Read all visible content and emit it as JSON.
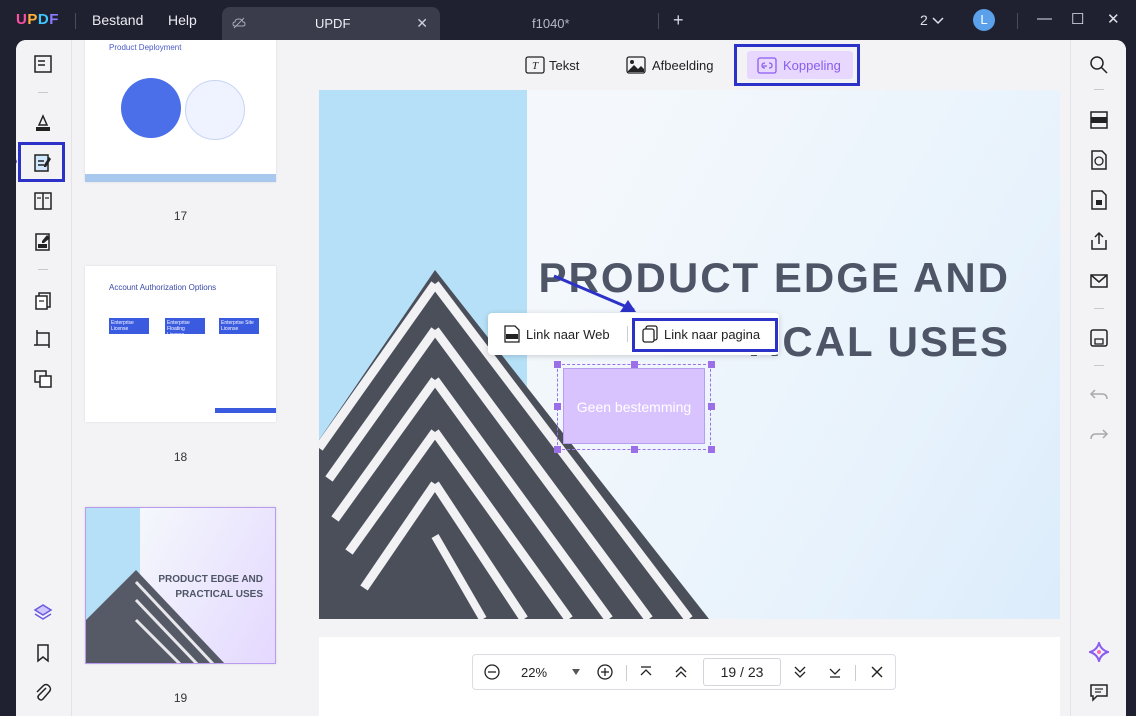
{
  "app": {
    "logo": "UPDF",
    "menu": [
      "Bestand",
      "Help"
    ],
    "tabs": [
      {
        "title": "UPDF",
        "close": "✕"
      },
      {
        "title": "f1040*"
      }
    ],
    "new_tab": "+",
    "window_count": "2",
    "avatar_initial": "L"
  },
  "edit_toolbar": {
    "text_label": "Tekst",
    "image_label": "Afbeelding",
    "link_label": "Koppeling"
  },
  "thumbnails": [
    {
      "page": "17",
      "title": "Product Deployment"
    },
    {
      "page": "18",
      "title": "Account Authorization Options",
      "items": [
        "Enterprise License",
        "Enterprise Floating License",
        "Enterprise Site License"
      ]
    },
    {
      "page": "19",
      "title": "PRODUCT EDGE AND PRACTICAL USES"
    }
  ],
  "slide": {
    "title_line1": "PRODUCT EDGE AND",
    "title_line2": "TICAL USES"
  },
  "link_popup": {
    "web_label": "Link naar Web",
    "page_label": "Link naar pagina"
  },
  "link_box": {
    "text": "Geen bestemming"
  },
  "zoom": {
    "value": "22%",
    "current_page": "19",
    "separator": "/",
    "total_pages": "23"
  },
  "colors": {
    "accent": "#8a5cf0",
    "highlight": "#2c32c8",
    "link_fill": "#d9c3ff"
  }
}
